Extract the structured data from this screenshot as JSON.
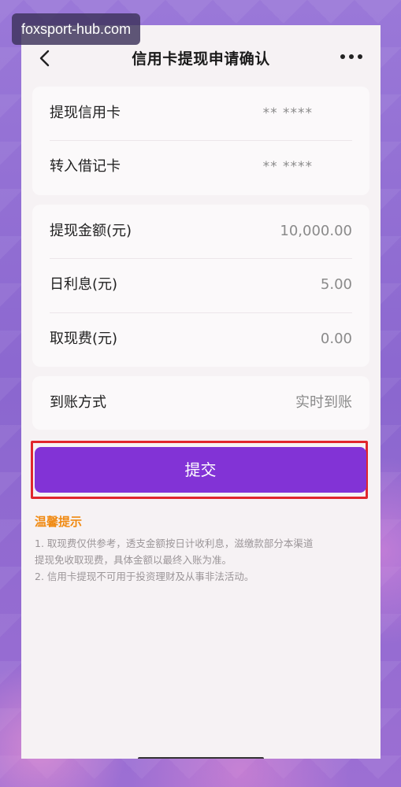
{
  "watermark": "foxsport-hub.com",
  "header": {
    "title": "信用卡提现申请确认"
  },
  "cards_section": {
    "credit_card": {
      "label": "提现信用卡",
      "value": "** ****"
    },
    "debit_card": {
      "label": "转入借记卡",
      "value": "** ****"
    }
  },
  "amount_section": {
    "withdraw_amount": {
      "label": "提现金额(元)",
      "value": "10,000.00"
    },
    "daily_interest": {
      "label": "日利息(元)",
      "value": "5.00"
    },
    "cash_fee": {
      "label": "取现费(元)",
      "value": "0.00"
    }
  },
  "arrival_section": {
    "arrival_method": {
      "label": "到账方式",
      "value": "实时到账"
    }
  },
  "submit_label": "提交",
  "tips": {
    "title": "温馨提示",
    "items": [
      "1. 取现费仅供参考，透支金额按日计收利息，滋缴款部分本渠道",
      "提现免收取现费，具体金额以最终入账为准。",
      "2. 信用卡提现不可用于投资理财及从事非法活动。"
    ]
  },
  "colors": {
    "accent": "#8233d6",
    "highlight_border": "#e0262d",
    "tips_title": "#f08a12",
    "background": "#8e6ad2"
  },
  "icons": {
    "back": "chevron-left-icon",
    "more": "more-dots-icon"
  }
}
